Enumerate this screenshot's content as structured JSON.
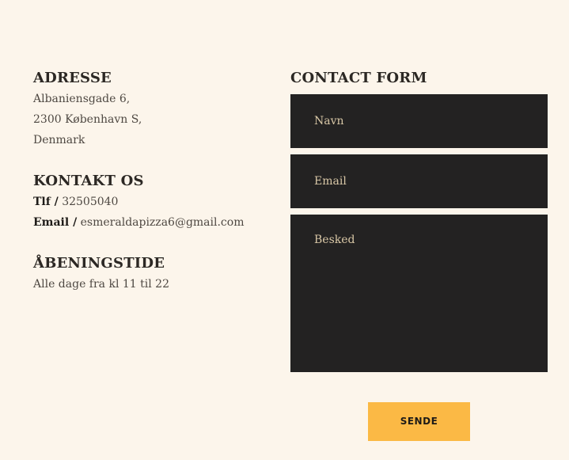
{
  "address": {
    "heading": "ADRESSE",
    "lines": [
      "Albaniensgade 6,",
      "2300 København S,",
      "Denmark"
    ]
  },
  "contact": {
    "heading": "KONTAKT OS",
    "phone_label": "Tlf /",
    "phone_value": "32505040",
    "email_label": "Email /",
    "email_value": "esmeraldapizza6@gmail.com"
  },
  "hours": {
    "heading": "ÅBENINGSTIDE",
    "text": "Alle dage fra kl 11 til 22"
  },
  "form": {
    "heading": "CONTACT FORM",
    "name_placeholder": "Navn",
    "email_placeholder": "Email",
    "message_placeholder": "Besked",
    "submit_label": "SENDE"
  },
  "colors": {
    "background": "#fcf5eb",
    "field_background": "#232222",
    "placeholder": "#d8c7a6",
    "button": "#fbb945"
  }
}
